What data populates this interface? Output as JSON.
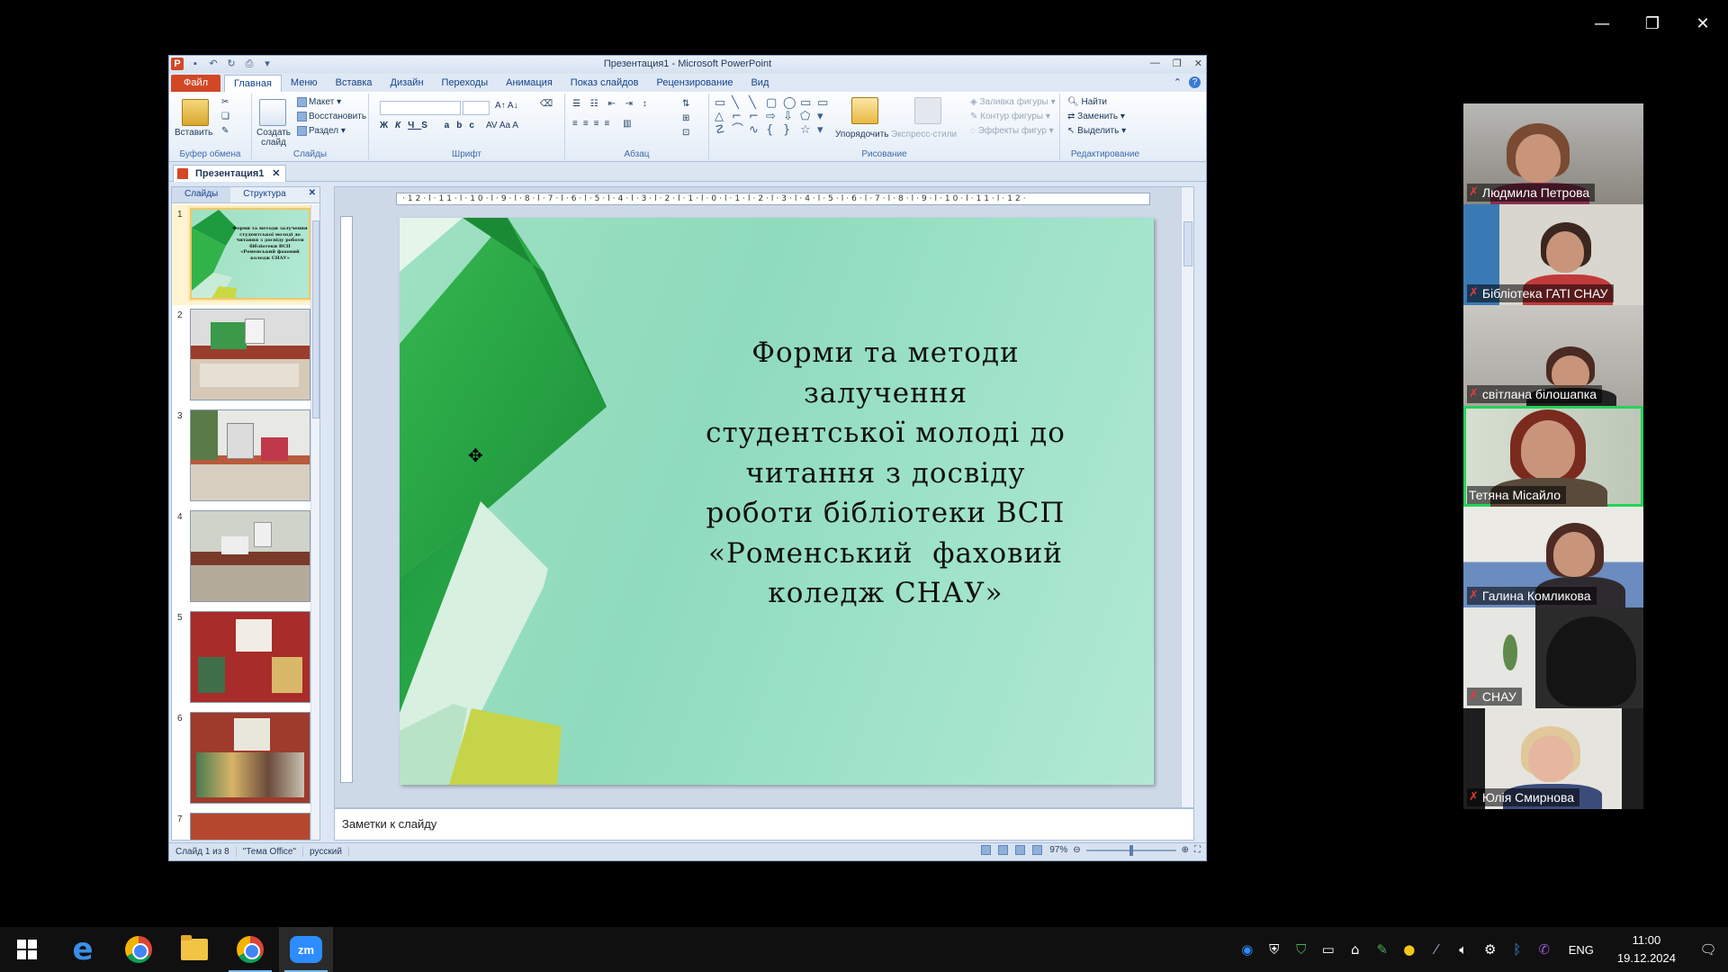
{
  "window_controls": {
    "minimize": "—",
    "restore": "❐",
    "close": "✕"
  },
  "powerpoint": {
    "title": "Презентация1 - Microsoft PowerPoint",
    "tabs": [
      "Файл",
      "Главная",
      "Меню",
      "Вставка",
      "Дизайн",
      "Переходы",
      "Анимация",
      "Показ слайдов",
      "Рецензирование",
      "Вид"
    ],
    "active_tab": "Главная",
    "ribbon": {
      "clipboard": {
        "paste": "Вставить",
        "label": "Буфер обмена"
      },
      "slides": {
        "new_slide": "Создать слайд",
        "layout": "Макет",
        "reset": "Восстановить",
        "section": "Раздел",
        "label": "Слайды"
      },
      "font": {
        "label": "Шрифт"
      },
      "paragraph": {
        "label": "Абзац"
      },
      "drawing": {
        "arrange": "Упорядочить",
        "quick_styles": "Экспресс-стили",
        "fill": "Заливка фигуры",
        "outline": "Контур фигуры",
        "effects": "Эффекты фигур",
        "label": "Рисование"
      },
      "editing": {
        "find": "Найти",
        "replace": "Заменить",
        "select": "Выделить",
        "label": "Редактирование"
      }
    },
    "document_tab": "Презентация1",
    "pane_tabs": {
      "slides": "Слайды",
      "outline": "Структура"
    },
    "thumbnails": [
      {
        "num": "1",
        "text": "Форми та методи залучення студентської молоді до читання з досвіду роботи бібліотеки ВСП «Роменський фаховий коледж СНАУ»"
      },
      {
        "num": "2"
      },
      {
        "num": "3"
      },
      {
        "num": "4"
      },
      {
        "num": "5"
      },
      {
        "num": "6"
      },
      {
        "num": "7"
      }
    ],
    "ruler_h": "·12·l·11·l·10·l·9·l·8·l·7·l·6·l·5·l·4·l·3·l·2·l·1·l·0·l·1·l·2·l·3·l·4·l·5·l·6·l·7·l·8·l·9·l·10·l·11·l·12·",
    "slide": {
      "title_lines": [
        "Форми та методи",
        "залучення",
        "студентської молоді до",
        "читання з досвіду",
        "роботи бібліотеки ВСП",
        "«Роменський  фаховий",
        "коледж СНАУ»"
      ]
    },
    "notes_placeholder": "Заметки к слайду",
    "status": {
      "slide_info": "Слайд 1 из 8",
      "theme": "\"Тема Office\"",
      "language": "русский",
      "zoom": "97%"
    }
  },
  "participants": [
    {
      "name": "Людмила Петрова",
      "active": false
    },
    {
      "name": "Бібліотека ГАТІ СНАУ",
      "active": false
    },
    {
      "name": "світлана білошапка",
      "active": false
    },
    {
      "name": "Тетяна Місайло",
      "active": true
    },
    {
      "name": "Галина Комликова",
      "active": false
    },
    {
      "name": "СНАУ",
      "active": false
    },
    {
      "name": "Юлія Смирнова",
      "active": false
    }
  ],
  "taskbar": {
    "apps": [
      "windows-start",
      "edge",
      "chrome",
      "file-explorer",
      "chrome",
      "zoom"
    ],
    "zoom_label": "zm",
    "language": "ENG",
    "time": "11:00",
    "date": "19.12.2024"
  },
  "colors": {
    "ppt_accent": "#d24726",
    "active_speaker": "#24d35a",
    "zoom_blue": "#2d8cff"
  }
}
